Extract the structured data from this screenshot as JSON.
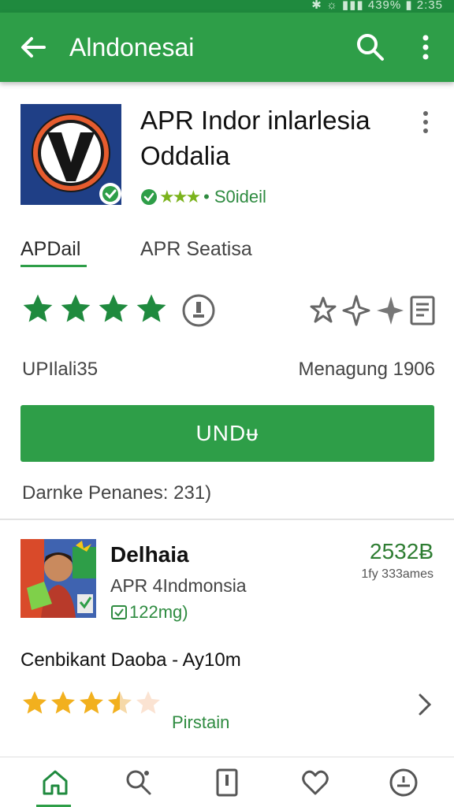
{
  "status_bar": {
    "text": "✱ ☼ ▮▮▮ 439% ▮ 2:35"
  },
  "app_bar": {
    "title": "Alndonesai"
  },
  "app": {
    "title_line1": "APR Indor inlarlesia",
    "title_line2": "Oddalia",
    "rating_label": "S0ideil",
    "rating_stars": "★★★"
  },
  "tabs": [
    {
      "label": "APDail"
    },
    {
      "label": "APR Seatisa"
    }
  ],
  "stats": {
    "left": "UPIlali35",
    "right": "Menagung 1906"
  },
  "install_button": {
    "label": "UNDᵾ"
  },
  "downloads": "Darnke Penanes: 231)",
  "card": {
    "title": "Delhaia",
    "subtitle": "APR 4Indmonsia",
    "tag": "122mg)",
    "price": "2532Ƀ",
    "count": "1fy 333ames",
    "line": "Cenbikant Daoba - Ay10m",
    "link": "Pirstain",
    "rating": 3.5
  },
  "colors": {
    "primary": "#2e9e48",
    "primary_dark": "#1f8a3e",
    "star_green": "#1f8a3e",
    "star_gold": "#f2b01e"
  }
}
